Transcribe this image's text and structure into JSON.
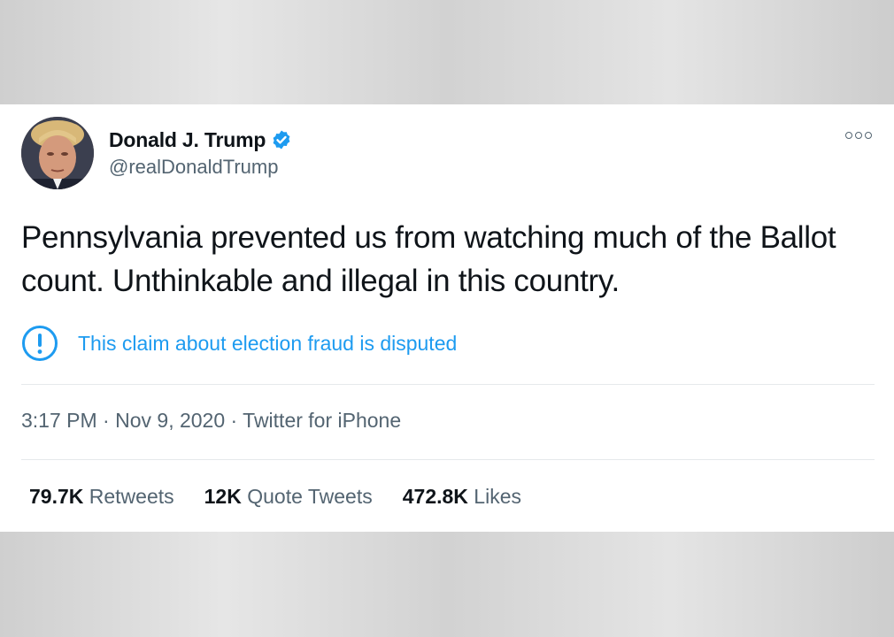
{
  "tweet": {
    "author": {
      "display_name": "Donald J. Trump",
      "handle": "@realDonaldTrump",
      "verified": true,
      "verified_color": "#1d9bf0"
    },
    "text": "Pennsylvania prevented us from watching much of the Ballot count. Unthinkable and illegal in this country.",
    "notice": {
      "icon": "alert-circle-icon",
      "text": "This claim about election fraud is disputed",
      "color": "#1d9bf0"
    },
    "meta": {
      "time": "3:17 PM",
      "separator": " · ",
      "date": "Nov 9, 2020",
      "source": "Twitter for iPhone"
    },
    "stats": [
      {
        "value": "79.7K",
        "label": "Retweets"
      },
      {
        "value": "12K",
        "label": "Quote Tweets"
      },
      {
        "value": "472.8K",
        "label": "Likes"
      }
    ]
  }
}
